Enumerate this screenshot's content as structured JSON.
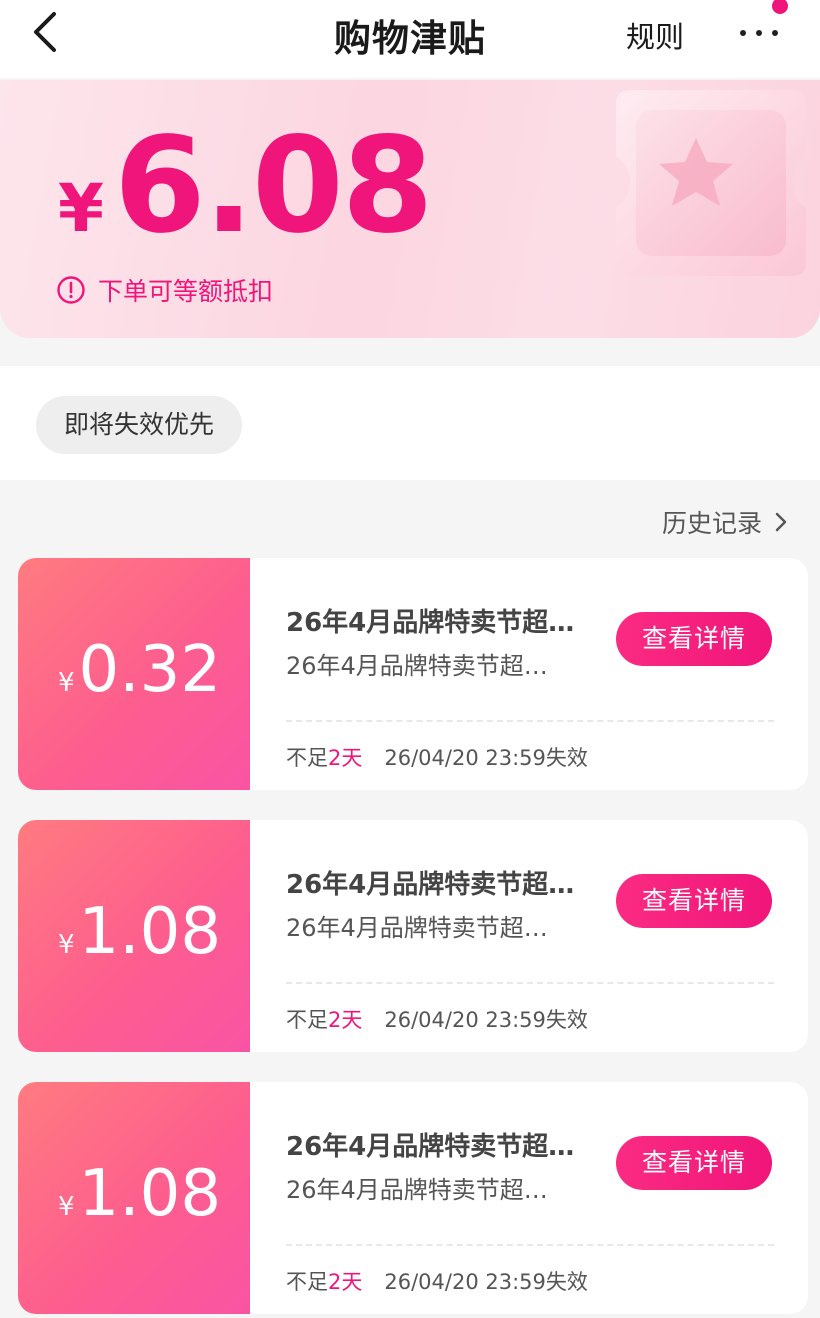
{
  "header": {
    "title": "购物津贴",
    "rules_label": "规则"
  },
  "hero": {
    "currency": "¥",
    "amount": "6.08",
    "note": "下单可等额抵扣"
  },
  "filter": {
    "chip_label": "即将失效优先"
  },
  "history": {
    "label": "历史记录"
  },
  "coupons": [
    {
      "currency": "¥",
      "value": "0.32",
      "title": "26年4月品牌特卖节超…",
      "subtitle": "26年4月品牌特卖节超…",
      "button_label": "查看详情",
      "expiry_prefix": "不足",
      "expiry_days": "2天",
      "expiry_date": "26/04/20 23:59失效"
    },
    {
      "currency": "¥",
      "value": "1.08",
      "title": "26年4月品牌特卖节超…",
      "subtitle": "26年4月品牌特卖节超…",
      "button_label": "查看详情",
      "expiry_prefix": "不足",
      "expiry_days": "2天",
      "expiry_date": "26/04/20 23:59失效"
    },
    {
      "currency": "¥",
      "value": "1.08",
      "title": "26年4月品牌特卖节超…",
      "subtitle": "26年4月品牌特卖节超…",
      "button_label": "查看详情",
      "expiry_prefix": "不足",
      "expiry_days": "2天",
      "expiry_date": "26/04/20 23:59失效"
    }
  ],
  "colors": {
    "accent": "#f0157a",
    "coupon_gradient_start": "#ff7b80",
    "coupon_gradient_end": "#f954a4",
    "hero_background": "#fcd6e1"
  },
  "icons": {
    "back": "chevron-left-icon",
    "more": "more-dots-icon",
    "info": "info-circle-icon",
    "history_arrow": "chevron-right-icon",
    "decoration": "ticket-star-icon"
  }
}
